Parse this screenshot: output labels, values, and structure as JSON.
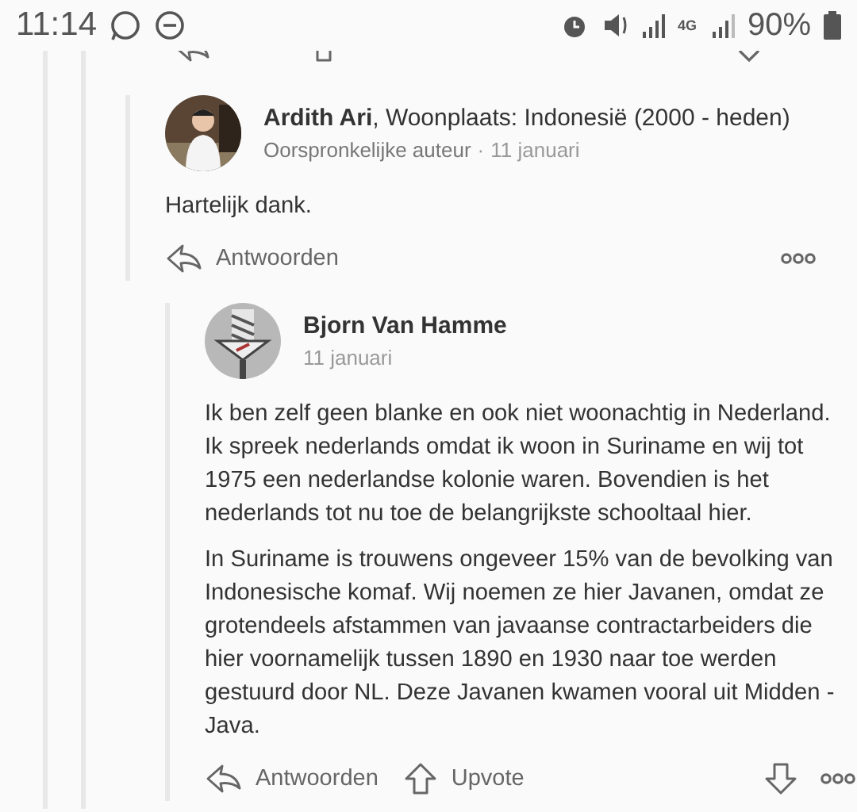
{
  "status_bar": {
    "time": "11:14",
    "network": "4G",
    "battery": "90%"
  },
  "comments": [
    {
      "author": "Ardith Ari",
      "credential": ", Woonplaats: Indonesië (2000 - heden)",
      "role": "Oorspronkelijke auteur",
      "separator": "·",
      "date": "11 januari",
      "paragraphs": [
        "Hartelijk dank."
      ],
      "actions": [
        "Antwoorden"
      ],
      "vote": false
    },
    {
      "author": "Bjorn Van Hamme",
      "date": "11 januari",
      "paragraphs": [
        "Ik ben zelf geen blanke en ook niet woonachtig in Nederland. Ik spreek nederlands omdat ik woon in Suriname en wij tot 1975 een nederlandse kolonie waren. Bovendien is het nederlands tot nu toe de belangrijkste schooltaal hier.",
        "In Suriname is trouwens ongeveer 15% van de bevolking van Indonesische komaf. Wij noemen ze hier Javanen, omdat ze grotendeels afstammen van javaanse contractarbeiders die hier voornamelijk tussen 1890 en 1930 naar toe werden gestuurd door NL. Deze Javanen kwamen vooral uit Midden - Java."
      ],
      "actions": [
        "Antwoorden",
        "Upvote"
      ],
      "vote": true
    }
  ]
}
